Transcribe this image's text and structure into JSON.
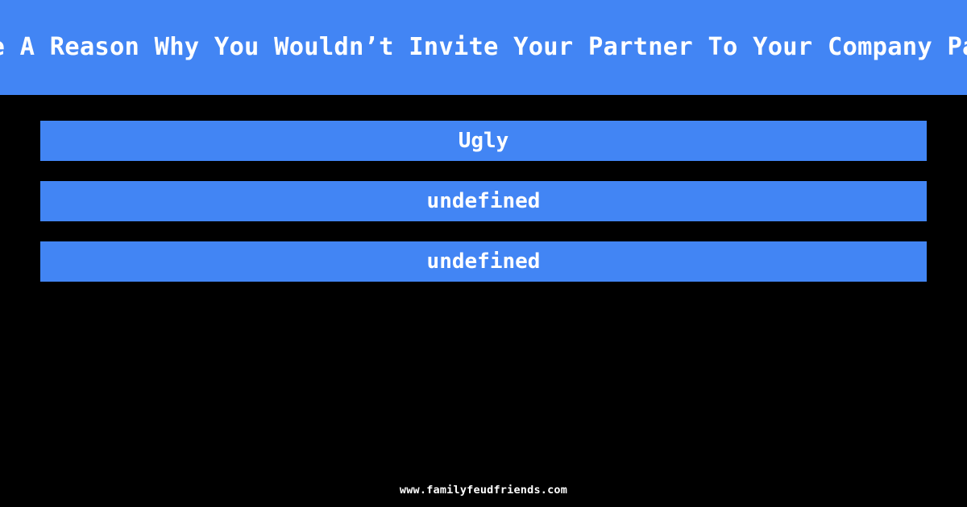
{
  "header": {
    "question": "Name A Reason Why You Wouldn’t Invite Your Partner To Your Company Party",
    "background_color": "#4285f4",
    "text_color": "#ffffff"
  },
  "answers": {
    "bar_color": "#4285f4",
    "text_color": "#ffffff",
    "items": [
      {
        "label": "Ugly"
      },
      {
        "label": "undefined"
      },
      {
        "label": "undefined"
      }
    ]
  },
  "page": {
    "background_color": "#000000"
  },
  "footer": {
    "url": "www.familyfeudfriends.com",
    "text_color": "#ffffff"
  }
}
